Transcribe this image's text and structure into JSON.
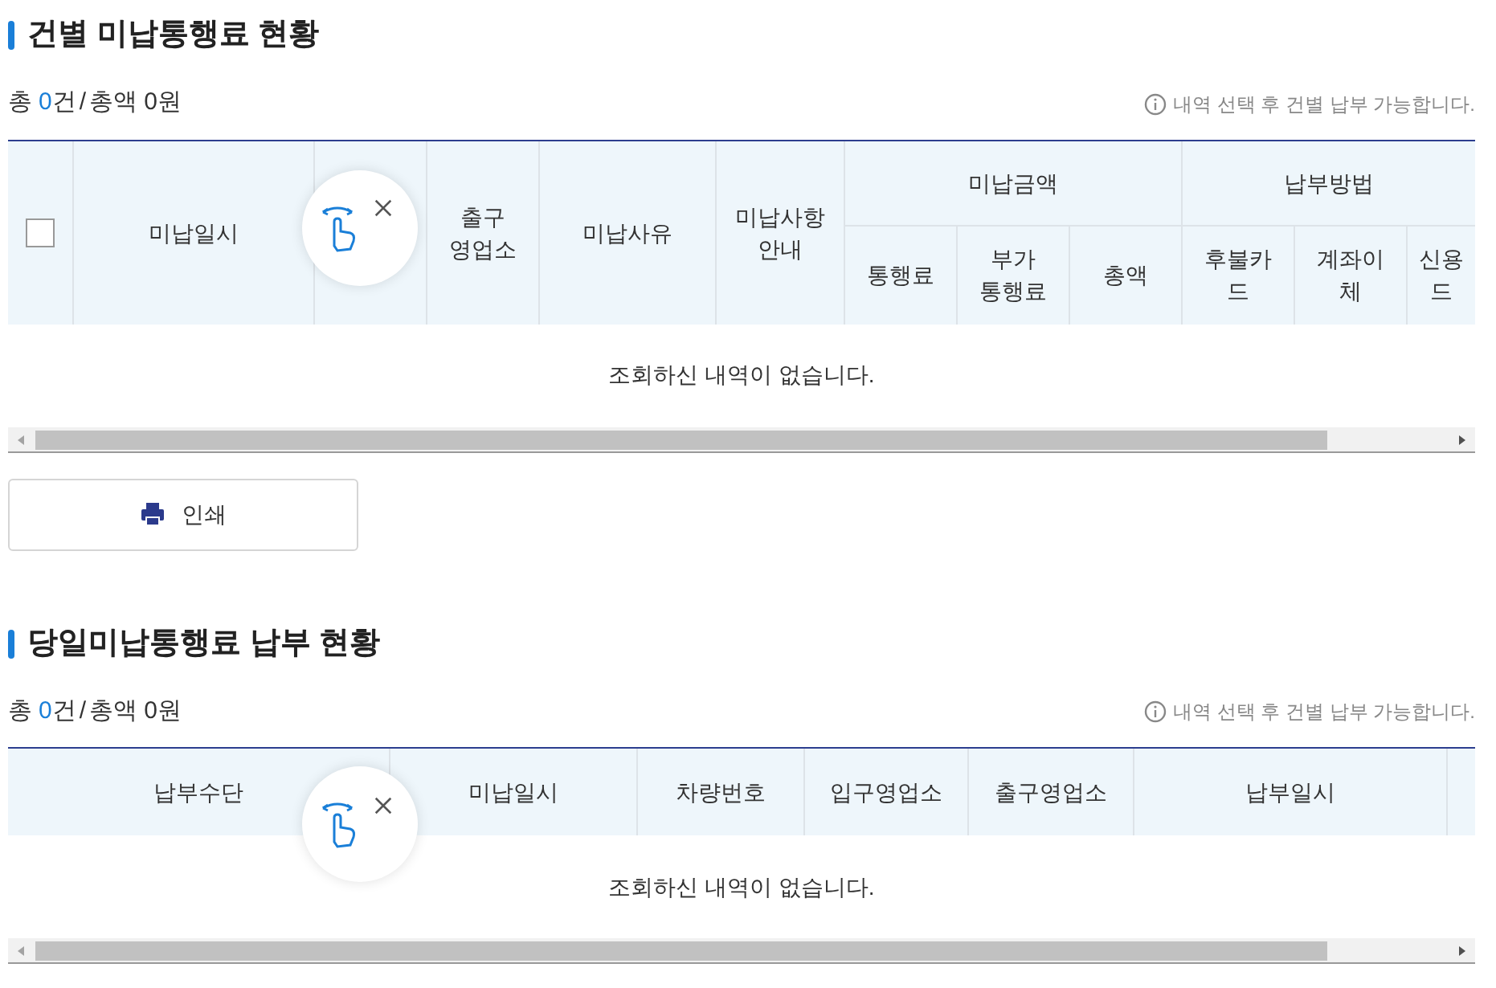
{
  "sections": [
    {
      "title": "건별 미납통행료 현황",
      "summary": {
        "prefix": "총",
        "count": "0",
        "count_unit": "건",
        "separator": "/",
        "amount": "총액 0원"
      },
      "notice": "내역 선택 후 건별 납부 가능합니다.",
      "columns": [
        {
          "kind": "checkbox",
          "checked": false
        },
        {
          "kind": "text",
          "lines": [
            "미납일시"
          ]
        },
        {
          "kind": "blank"
        },
        {
          "kind": "text",
          "lines": [
            "출구",
            "영업소"
          ]
        },
        {
          "kind": "text",
          "lines": [
            "미납사유"
          ]
        },
        {
          "kind": "text",
          "lines": [
            "미납사항",
            "안내"
          ]
        },
        {
          "kind": "group",
          "lines": [
            "미납금액"
          ],
          "children": [
            {
              "lines": [
                "통행료"
              ]
            },
            {
              "lines": [
                "부가",
                "통행료"
              ]
            },
            {
              "lines": [
                "총액"
              ]
            }
          ]
        },
        {
          "kind": "group",
          "lines": [
            "납부방법"
          ],
          "children": [
            {
              "lines": [
                "후불카",
                "드"
              ]
            },
            {
              "lines": [
                "계좌이",
                "체"
              ]
            },
            {
              "lines": [
                "신용",
                "드"
              ]
            }
          ]
        }
      ],
      "empty_message": "조회하신 내역이 없습니다.",
      "print_button": "인쇄"
    },
    {
      "title": "당일미납통행료 납부 현황",
      "summary": {
        "prefix": "총",
        "count": "0",
        "count_unit": "건",
        "separator": "/",
        "amount": "총액 0원"
      },
      "notice": "내역 선택 후 건별 납부 가능합니다.",
      "columns": [
        {
          "kind": "text",
          "lines": [
            "납부수단"
          ]
        },
        {
          "kind": "text",
          "lines": [
            "미납일시"
          ]
        },
        {
          "kind": "text",
          "lines": [
            "차량번호"
          ]
        },
        {
          "kind": "text",
          "lines": [
            "입구영업소"
          ]
        },
        {
          "kind": "text",
          "lines": [
            "출구영업소"
          ]
        },
        {
          "kind": "text",
          "lines": [
            "납부일시"
          ]
        },
        {
          "kind": "blank"
        }
      ],
      "empty_message": "조회하신 내역이 없습니다."
    }
  ]
}
